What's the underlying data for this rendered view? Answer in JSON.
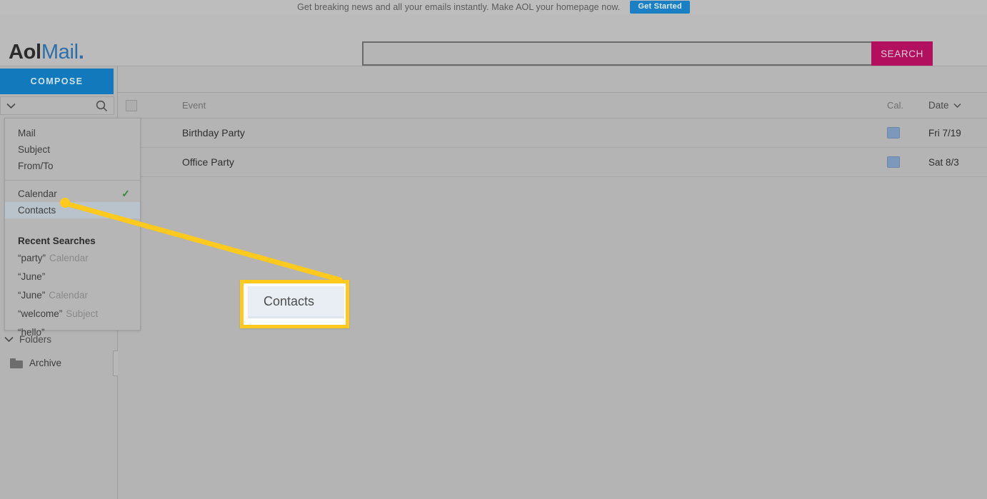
{
  "promo": {
    "text": "Get breaking news and all your emails instantly. Make AOL your homepage now.",
    "button_label": "Get Started",
    "button_color": "#1b7fc4"
  },
  "masthead": {
    "logo_aol": "Aol",
    "logo_mail": "Mail",
    "logo_dot": ".",
    "logo_color_primary": "#2b2b2b",
    "logo_color_accent": "#2d6fa8"
  },
  "search": {
    "value": "",
    "placeholder": "",
    "button_label": "SEARCH",
    "button_color": "#b2105f",
    "chevron_icon": "chevron-down-icon",
    "magnifier_icon": "search-icon"
  },
  "sidebar": {
    "compose_label": "COMPOSE",
    "compose_color": "#1279bd",
    "folders_label": "Folders",
    "folders_chevron": "chevron-down-icon",
    "archive_label": "Archive",
    "archive_icon": "folder-icon"
  },
  "dropdown": {
    "scopes": [
      {
        "label": "Mail",
        "checked": false,
        "selected": false
      },
      {
        "label": "Subject",
        "checked": false,
        "selected": false
      },
      {
        "label": "From/To",
        "checked": false,
        "selected": false
      }
    ],
    "apps": [
      {
        "label": "Calendar",
        "checked": true,
        "selected": false,
        "check_glyph": "✓",
        "check_color": "#2f8a3e"
      },
      {
        "label": "Contacts",
        "checked": false,
        "selected": true
      }
    ],
    "recent_heading": "Recent Searches",
    "recent": [
      {
        "term": "“party”",
        "scope": "Calendar"
      },
      {
        "term": "“June”",
        "scope": ""
      },
      {
        "term": "“June”",
        "scope": "Calendar"
      },
      {
        "term": "“welcome”",
        "scope": "Subject"
      },
      {
        "term": "“hello”",
        "scope": ""
      }
    ]
  },
  "list": {
    "select_all_icon": "checkbox-icon",
    "columns": {
      "event": "Event",
      "cal": "Cal.",
      "date": "Date",
      "date_sort_icon": "chevron-down-icon"
    },
    "rows": [
      {
        "event": "Birthday Party",
        "cal_color": "#7c99bb",
        "date": "Fri 7/19"
      },
      {
        "event": "Office Party",
        "cal_color": "#7c99bb",
        "date": "Sat 8/3"
      }
    ]
  },
  "annotation": {
    "callout_text": "Contacts",
    "highlight_color": "#ffc91e"
  }
}
